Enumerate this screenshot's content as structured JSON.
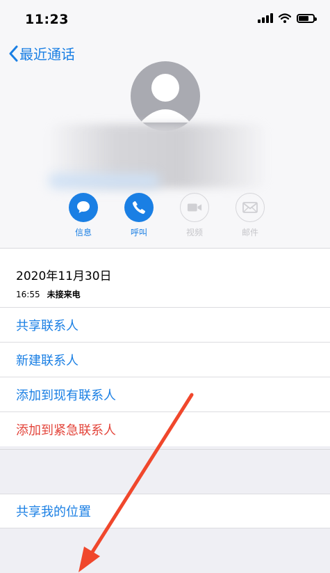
{
  "status_bar": {
    "time": "11:23"
  },
  "nav": {
    "back_label": "最近通话"
  },
  "actions": [
    {
      "label": "信息",
      "icon": "message-icon",
      "enabled": true
    },
    {
      "label": "呼叫",
      "icon": "phone-icon",
      "enabled": true
    },
    {
      "label": "视频",
      "icon": "video-icon",
      "enabled": false
    },
    {
      "label": "邮件",
      "icon": "mail-icon",
      "enabled": false
    }
  ],
  "call_info": {
    "date": "2020年11月30日",
    "time": "16:55",
    "status": "未接来电"
  },
  "menu": [
    {
      "label": "共享联系人"
    },
    {
      "label": "新建联系人"
    },
    {
      "label": "添加到现有联系人"
    },
    {
      "label": "添加到紧急联系人"
    }
  ],
  "share_location": {
    "label": "共享我的位置"
  },
  "colors": {
    "accent": "#1a7fe4",
    "danger": "#e3453b",
    "annotation_arrow": "#f0472c"
  }
}
